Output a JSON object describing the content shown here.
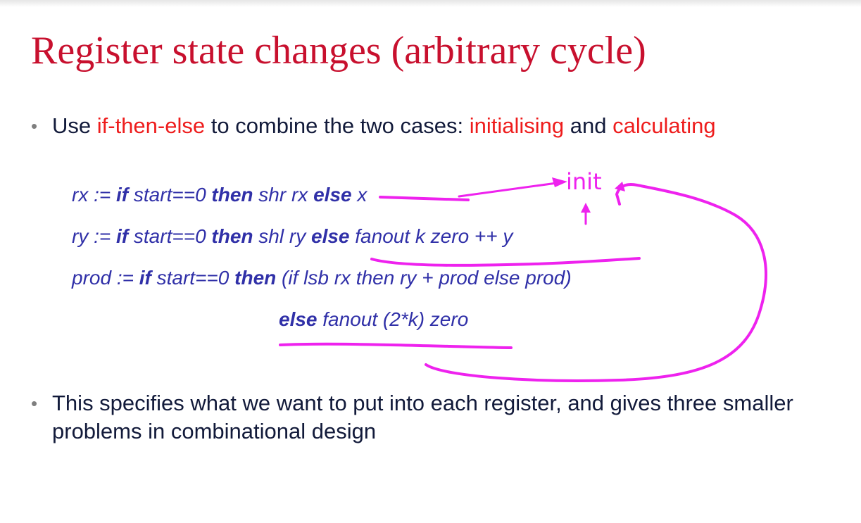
{
  "title": "Register state changes (arbitrary cycle)",
  "bullet1": {
    "part1": "Use ",
    "part2": "if-then-else",
    "part3": " to combine the two cases: ",
    "part4": "initialising",
    "part5": " and ",
    "part6": "calculating"
  },
  "code": {
    "line1": {
      "t1": "rx := ",
      "t2": "if",
      "t3": " start==0 ",
      "t4": "then",
      "t5": " shr rx ",
      "t6": "else",
      "t7": " x"
    },
    "line2": {
      "t1": "ry := ",
      "t2": "if",
      "t3": " start==0 ",
      "t4": "then",
      "t5": " shl ry ",
      "t6": "else",
      "t7": " fanout k zero ++ y"
    },
    "line3": {
      "t1": "prod := ",
      "t2": "if",
      "t3": " start==0 ",
      "t4": "then",
      "t5": " (if lsb rx then ry + prod else prod)"
    },
    "line4": {
      "t1": "else",
      "t2": " fanout (2*k) zero"
    }
  },
  "annotation": {
    "label": "init",
    "color": "#ee22ee"
  },
  "bullet2": {
    "text": "This specifies what we want to put into each register, and gives three smaller problems in combinational design"
  },
  "colors": {
    "title": "#c8102e",
    "accent": "#ee1c1c",
    "code": "#3030a8",
    "body": "#121a3a"
  }
}
